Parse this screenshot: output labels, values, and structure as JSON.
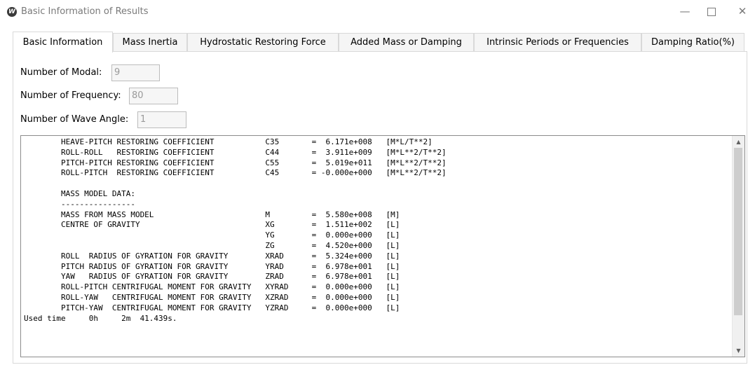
{
  "window": {
    "title": "Basic Information of Results",
    "icon": "W"
  },
  "tabs": [
    {
      "label": "Basic Information",
      "active": true
    },
    {
      "label": "Mass Inertia"
    },
    {
      "label": "Hydrostatic Restoring Force"
    },
    {
      "label": "Added Mass or Damping"
    },
    {
      "label": "Intrinsic Periods or Frequencies"
    },
    {
      "label": "Damping Ratio(%)"
    }
  ],
  "fields": {
    "modal": {
      "label": "Number of Modal:",
      "value": "9"
    },
    "frequency": {
      "label": "Number of Frequency:",
      "value": "80"
    },
    "wave_angle": {
      "label": "Number of Wave Angle:",
      "value": "1"
    }
  },
  "output_lines": [
    "        HEAVE-PITCH RESTORING COEFFICIENT           C35       =  6.171e+008   [M*L/T**2]",
    "        ROLL-ROLL   RESTORING COEFFICIENT           C44       =  3.911e+009   [M*L**2/T**2]",
    "        PITCH-PITCH RESTORING COEFFICIENT           C55       =  5.019e+011   [M*L**2/T**2]",
    "        ROLL-PITCH  RESTORING COEFFICIENT           C45       = -0.000e+000   [M*L**2/T**2]",
    "",
    "        MASS MODEL DATA:",
    "        ----------------",
    "        MASS FROM MASS MODEL                        M         =  5.580e+008   [M]",
    "        CENTRE OF GRAVITY                           XG        =  1.511e+002   [L]",
    "                                                    YG        =  0.000e+000   [L]",
    "                                                    ZG        =  4.520e+000   [L]",
    "        ROLL  RADIUS OF GYRATION FOR GRAVITY        XRAD      =  5.324e+000   [L]",
    "        PITCH RADIUS OF GYRATION FOR GRAVITY        YRAD      =  6.978e+001   [L]",
    "        YAW   RADIUS OF GYRATION FOR GRAVITY        ZRAD      =  6.978e+001   [L]",
    "        ROLL-PITCH CENTRIFUGAL MOMENT FOR GRAVITY   XYRAD     =  0.000e+000   [L]",
    "        ROLL-YAW   CENTRIFUGAL MOMENT FOR GRAVITY   XZRAD     =  0.000e+000   [L]",
    "        PITCH-YAW  CENTRIFUGAL MOMENT FOR GRAVITY   YZRAD     =  0.000e+000   [L]",
    "Used time     0h     2m  41.439s."
  ]
}
